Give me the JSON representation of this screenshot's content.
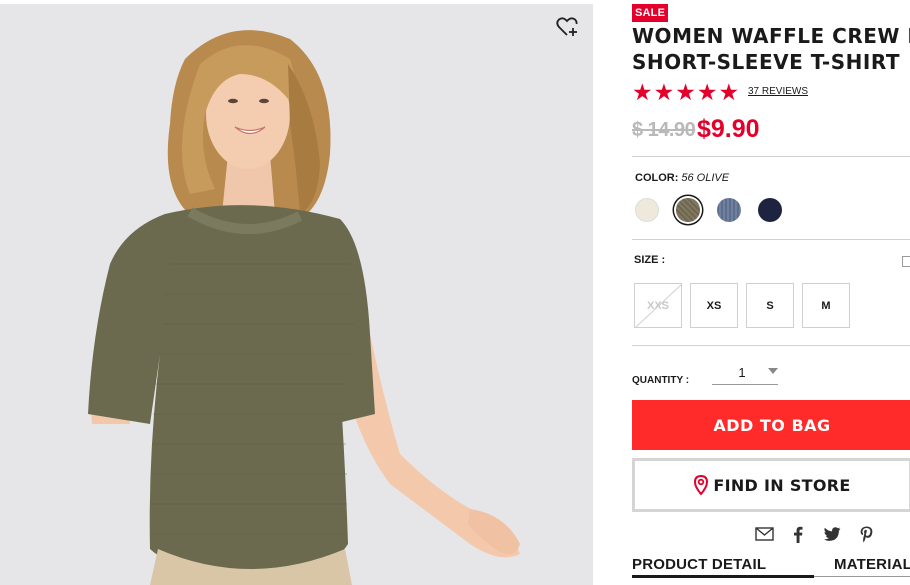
{
  "product": {
    "badge": "SALE",
    "title_line1": "WOMEN WAFFLE CREW NECK",
    "title_line2": "SHORT-SLEEVE T-SHIRT",
    "rating": 5,
    "reviews_text": "37 REVIEWS",
    "original_price": "$ 14.90",
    "sale_price": "$9.90"
  },
  "color": {
    "label": "COLOR:",
    "selected": "56 OLIVE",
    "swatches": [
      {
        "name": "off-white",
        "hex": "#efe9dc"
      },
      {
        "name": "olive",
        "hex": "#6f6650"
      },
      {
        "name": "blue",
        "hex": "#5d6d8c"
      },
      {
        "name": "navy",
        "hex": "#1e2440"
      }
    ]
  },
  "size": {
    "label": "SIZE :",
    "options": [
      "XXS",
      "XS",
      "S",
      "M"
    ],
    "unavailable": [
      "XXS"
    ]
  },
  "quantity": {
    "label": "QUANTITY :",
    "value": "1"
  },
  "actions": {
    "add_to_bag": "ADD TO BAG",
    "find_in_store": "FIND IN STORE"
  },
  "tabs": {
    "product_detail": "PRODUCT DETAIL",
    "material": "MATERIAL"
  },
  "colors": {
    "accent_red": "#e4002b",
    "button_red": "#ff2a2a"
  }
}
